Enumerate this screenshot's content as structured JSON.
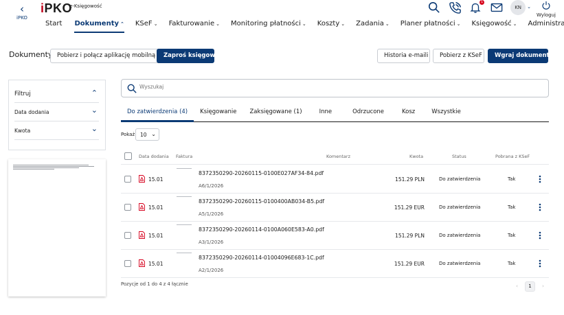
{
  "header": {
    "back_label": "iPKO",
    "logo_text": "PKO",
    "logo_i": "i",
    "product": "e-Księgowość",
    "avatar": "KN",
    "logout": "Wyloguj",
    "notifications_count": "1"
  },
  "nav": [
    {
      "label": "Start",
      "chevron": ""
    },
    {
      "label": "Dokumenty",
      "chevron": "⌃"
    },
    {
      "label": "KSeF",
      "chevron": "⌄"
    },
    {
      "label": "Fakturowanie",
      "chevron": "⌄"
    },
    {
      "label": "Monitoring płatności",
      "chevron": "⌄"
    },
    {
      "label": "Koszty",
      "chevron": "⌄"
    },
    {
      "label": "Zadania",
      "chevron": "⌄"
    },
    {
      "label": "Planer płatności",
      "chevron": "⌄"
    },
    {
      "label": "Księgowość",
      "chevron": "⌄"
    },
    {
      "label": "Administracja",
      "chevron": "⌄"
    }
  ],
  "toolbar": {
    "title": "Dokumenty",
    "mobile_btn": "Pobierz i połącz aplikację mobilną",
    "invite_btn": "Zaproś księgową",
    "emails_btn": "Historia e-maili",
    "ksef_btn": "Pobierz z KSeF",
    "upload_btn": "Wgraj dokumenty"
  },
  "filter": {
    "title": "Filtruj",
    "date_label": "Data dodania",
    "amount_label": "Kwota"
  },
  "search": {
    "placeholder": "Wyszukaj"
  },
  "tabs": [
    "Do zatwierdzenia (4)",
    "Księgowanie",
    "Zaksięgowane (1)",
    "Inne",
    "Odrzucone",
    "Kosz",
    "Wszystkie"
  ],
  "paging": {
    "show_label": "Pokaż",
    "page_size": "10",
    "summary": "Pozycje od 1 do 4 z 4 łącznie",
    "current_page": "1",
    "prev": "‹",
    "next": "›"
  },
  "table": {
    "headers": {
      "date": "Data dodania",
      "invoice": "Faktura",
      "comment": "Komentarz",
      "amount": "Kwota",
      "status": "Status",
      "ksef": "Pobrana z KSeF"
    },
    "rows": [
      {
        "date": "15.01",
        "file": "8372350290-20260115-0100E027AF34-84.pdf",
        "number": "A6/1/2026",
        "amount": "151.29 PLN",
        "status": "Do zatwierdzenia",
        "ksef": "Tak"
      },
      {
        "date": "15.01",
        "file": "8372350290-20260115-0100400AB034-B5.pdf",
        "number": "A5/1/2026",
        "amount": "151.29 EUR",
        "status": "Do zatwierdzenia",
        "ksef": "Tak"
      },
      {
        "date": "15.01",
        "file": "8372350290-20260114-0100A060E583-A0.pdf",
        "number": "A3/1/2026",
        "amount": "151.29 PLN",
        "status": "Do zatwierdzenia",
        "ksef": "Tak"
      },
      {
        "date": "15.01",
        "file": "8372350290-20260114-01004096E683-1C.pdf",
        "number": "A2/1/2026",
        "amount": "151.29 EUR",
        "status": "Do zatwierdzenia",
        "ksef": "Tak"
      }
    ]
  }
}
